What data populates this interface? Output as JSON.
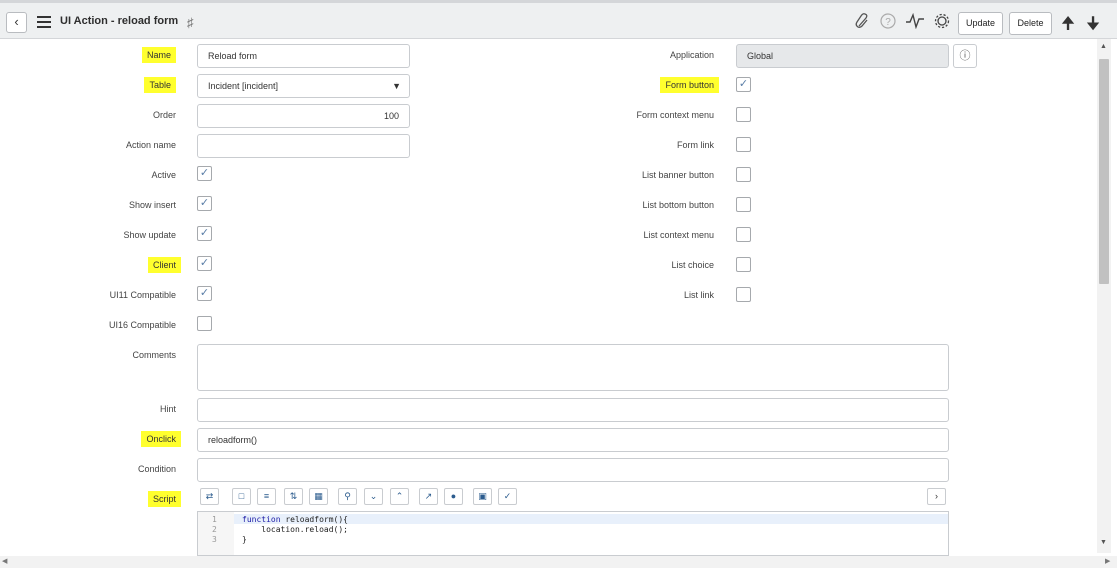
{
  "header": {
    "title": "UI Action - reload form",
    "back_icon": "chevron-left-icon",
    "update_label": "Update",
    "delete_label": "Delete"
  },
  "form": {
    "name": {
      "label": "Name",
      "value": "Reload form"
    },
    "table": {
      "label": "Table",
      "value": "Incident [incident]"
    },
    "order": {
      "label": "Order",
      "value": "100"
    },
    "action_name": {
      "label": "Action name",
      "value": ""
    },
    "active": {
      "label": "Active",
      "checked": true
    },
    "show_insert": {
      "label": "Show insert",
      "checked": true
    },
    "show_update": {
      "label": "Show update",
      "checked": true
    },
    "client": {
      "label": "Client",
      "checked": true
    },
    "ui11": {
      "label": "UI11 Compatible",
      "checked": true
    },
    "ui16": {
      "label": "UI16 Compatible",
      "checked": false
    },
    "comments": {
      "label": "Comments",
      "value": ""
    },
    "hint": {
      "label": "Hint",
      "value": ""
    },
    "onclick": {
      "label": "Onclick",
      "value": "reloadform()"
    },
    "condition": {
      "label": "Condition",
      "value": ""
    },
    "script": {
      "label": "Script",
      "lines": [
        {
          "num": "1",
          "text": "function reloadform(){"
        },
        {
          "num": "2",
          "text": "    location.reload();"
        },
        {
          "num": "3",
          "text": "}"
        }
      ]
    },
    "application": {
      "label": "Application",
      "value": "Global"
    },
    "form_button": {
      "label": "Form button",
      "checked": true
    },
    "form_context_menu": {
      "label": "Form context menu",
      "checked": false
    },
    "form_link": {
      "label": "Form link",
      "checked": false
    },
    "list_banner_button": {
      "label": "List banner button",
      "checked": false
    },
    "list_bottom_button": {
      "label": "List bottom button",
      "checked": false
    },
    "list_context_menu": {
      "label": "List context menu",
      "checked": false
    },
    "list_choice": {
      "label": "List choice",
      "checked": false
    },
    "list_link": {
      "label": "List link",
      "checked": false
    }
  },
  "checkmark": "✓",
  "colors": {
    "highlight": "#ffff2e",
    "check": "#5a7ea7"
  }
}
